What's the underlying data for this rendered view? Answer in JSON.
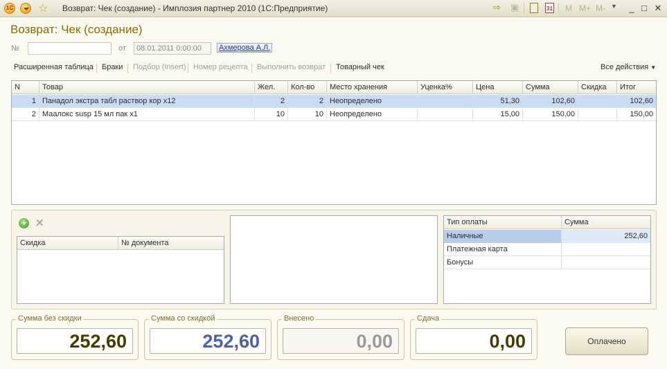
{
  "window": {
    "title": "Возврат: Чек (создание) - Имплозия партнер 2010  (1С:Предприятие)",
    "logo_text": "1С",
    "calendar_day": "31",
    "mem_buttons": [
      "M",
      "M+",
      "M-"
    ],
    "controls": [
      "_",
      "□",
      "✕"
    ]
  },
  "document": {
    "title": "Возврат: Чек (создание)",
    "number_label": "№",
    "number_value": "",
    "date_label": "от",
    "date_value": "08.01.2011  0:00:00",
    "author": "Ахмерова А.Л."
  },
  "commands": [
    {
      "label": "Расширенная таблица",
      "enabled": true
    },
    {
      "label": "Браки",
      "enabled": true
    },
    {
      "label": "Подбор (Insert)",
      "enabled": false
    },
    {
      "label": "Номер рецепта",
      "enabled": false
    },
    {
      "label": "Выполнить возврат",
      "enabled": false
    },
    {
      "label": "Товарный чек",
      "enabled": true
    }
  ],
  "all_actions": "Все действия",
  "goods_table": {
    "columns": [
      "N",
      "Товар",
      "Жел.",
      "Кол-во",
      "Место хранения",
      "Уценка%",
      "Цена",
      "Сумма",
      "Скидка",
      "Итог"
    ],
    "rows": [
      {
        "n": "1",
        "item": "Панадол экстра табл раствор кор х12",
        "wanted": "2",
        "qty": "2",
        "storage": "Неопределено",
        "markdown": "",
        "price": "51,30",
        "sum": "102,60",
        "discount": "",
        "total": "102,60"
      },
      {
        "n": "2",
        "item": "Маалокс susp 15 мл пак х1",
        "wanted": "10",
        "qty": "10",
        "storage": "Неопределено",
        "markdown": "",
        "price": "15,00",
        "sum": "150,00",
        "discount": "",
        "total": "150,00"
      }
    ],
    "selected_row": 0
  },
  "discount_table": {
    "columns": [
      "Скидка",
      "№ документа"
    ]
  },
  "payment_table": {
    "columns": [
      "Тип оплаты",
      "Сумма"
    ],
    "rows": [
      {
        "type": "Наличные",
        "sum": "252,60"
      },
      {
        "type": "Платежная карта",
        "sum": ""
      },
      {
        "type": "Бонусы",
        "sum": ""
      }
    ],
    "selected_row": 0
  },
  "totals": {
    "no_discount_label": "Сумма без скидки",
    "no_discount_value": "252,60",
    "with_discount_label": "Сумма со скидкой",
    "with_discount_value": "252,60",
    "paid_in_label": "Внесено",
    "paid_in_value": "0,00",
    "change_label": "Сдача",
    "change_value": "0,00"
  },
  "paid_button": "Оплачено",
  "colors": {
    "title_accent": "#8a6b00",
    "selection": "#c8dcf3",
    "with_discount_value": "#4a5fb5",
    "total_value": "#4a3a00",
    "disabled_value": "#9a9a9a"
  }
}
